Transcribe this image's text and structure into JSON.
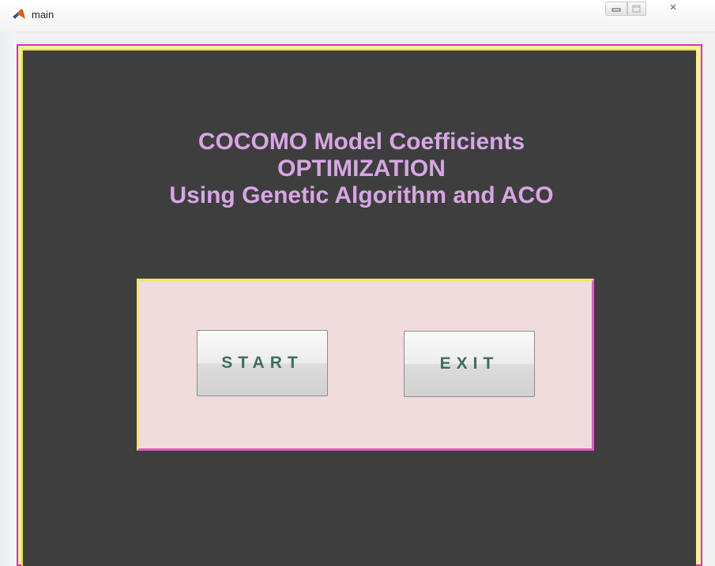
{
  "window": {
    "title": "main",
    "controls": {
      "minimize": "minimize",
      "maximize": "maximize",
      "close": "close"
    }
  },
  "heading": {
    "line1": "COCOMO Model Coefficients",
    "line2": "OPTIMIZATION",
    "line3": "Using Genetic Algorithm and ACO"
  },
  "buttons": {
    "start_label": "START",
    "exit_label": "EXIT"
  },
  "colors": {
    "figure_background": "#3e3e3e",
    "heading_text": "#d7a6e4",
    "panel_background": "#f0dcdc",
    "button_text": "#3f6e58",
    "frame_magenta": "#e030b8",
    "frame_yellow": "#e8df50"
  },
  "icons": {
    "app_icon": "matlab-icon",
    "minimize_icon": "minimize-icon",
    "maximize_icon": "maximize-icon",
    "close_icon": "close-icon"
  }
}
